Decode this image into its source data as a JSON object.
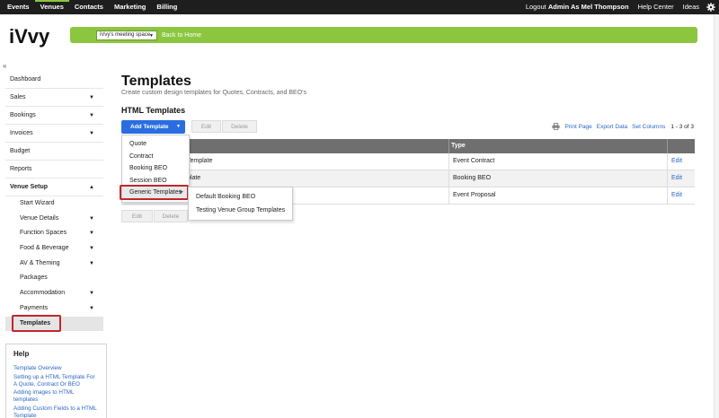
{
  "topbar": {
    "nav": [
      "Events",
      "Venues",
      "Contacts",
      "Marketing",
      "Billing"
    ],
    "active": "Venues",
    "logout_prefix": "Logout",
    "logout_user": "Admin As Mel Thompson",
    "help_center": "Help Center",
    "ideas": "Ideas"
  },
  "header": {
    "logo_text": "iVvy",
    "venue_select": "iVvy's meeting space",
    "back_home": "Back to Home",
    "accent_color": "#8cc63f"
  },
  "sidebar": {
    "collapse_icon": "«",
    "items": [
      {
        "label": "Dashboard"
      },
      {
        "label": "Sales"
      },
      {
        "label": "Bookings"
      },
      {
        "label": "Invoices"
      },
      {
        "label": "Budget"
      },
      {
        "label": "Reports"
      },
      {
        "label": "Venue Setup"
      }
    ],
    "sub_items": [
      {
        "label": "Start Wizard"
      },
      {
        "label": "Venue Details"
      },
      {
        "label": "Function Spaces"
      },
      {
        "label": "Food & Beverage"
      },
      {
        "label": "AV & Theming"
      },
      {
        "label": "Packages"
      },
      {
        "label": "Accommodation"
      },
      {
        "label": "Payments"
      },
      {
        "label": "Templates"
      }
    ]
  },
  "help": {
    "title": "Help",
    "links": [
      "Template Overview",
      "Setting up a HTML Template For A Quote, Contract Or BEO",
      "Adding images to HTML templates",
      "Adding Custom Fields to a HTML Template"
    ]
  },
  "main": {
    "title": "Templates",
    "subtitle": "Create custom design templates for Quotes, Contracts, and BEO's",
    "section_title": "HTML Templates",
    "add_button": "Add Template",
    "edit_button": "Edit",
    "delete_button": "Delete",
    "print_page": "Print Page",
    "export_data": "Export Data",
    "set_columns": "Set Columns",
    "count": "1 - 3 of 3",
    "table": {
      "col_type": "Type",
      "rows": [
        {
          "name": "Template",
          "type": "Event Contract",
          "action": "Edit"
        },
        {
          "name": "plate",
          "type": "Booking BEO",
          "action": "Edit"
        },
        {
          "name": "",
          "type": "Event Proposal",
          "action": "Edit"
        }
      ]
    }
  },
  "menu": {
    "items": [
      "Quote",
      "Contract",
      "Booking BEO",
      "Session BEO",
      "Generic Templates"
    ],
    "submenu": [
      "Default Booking BEO",
      "Testing Venue Group Templates"
    ]
  }
}
